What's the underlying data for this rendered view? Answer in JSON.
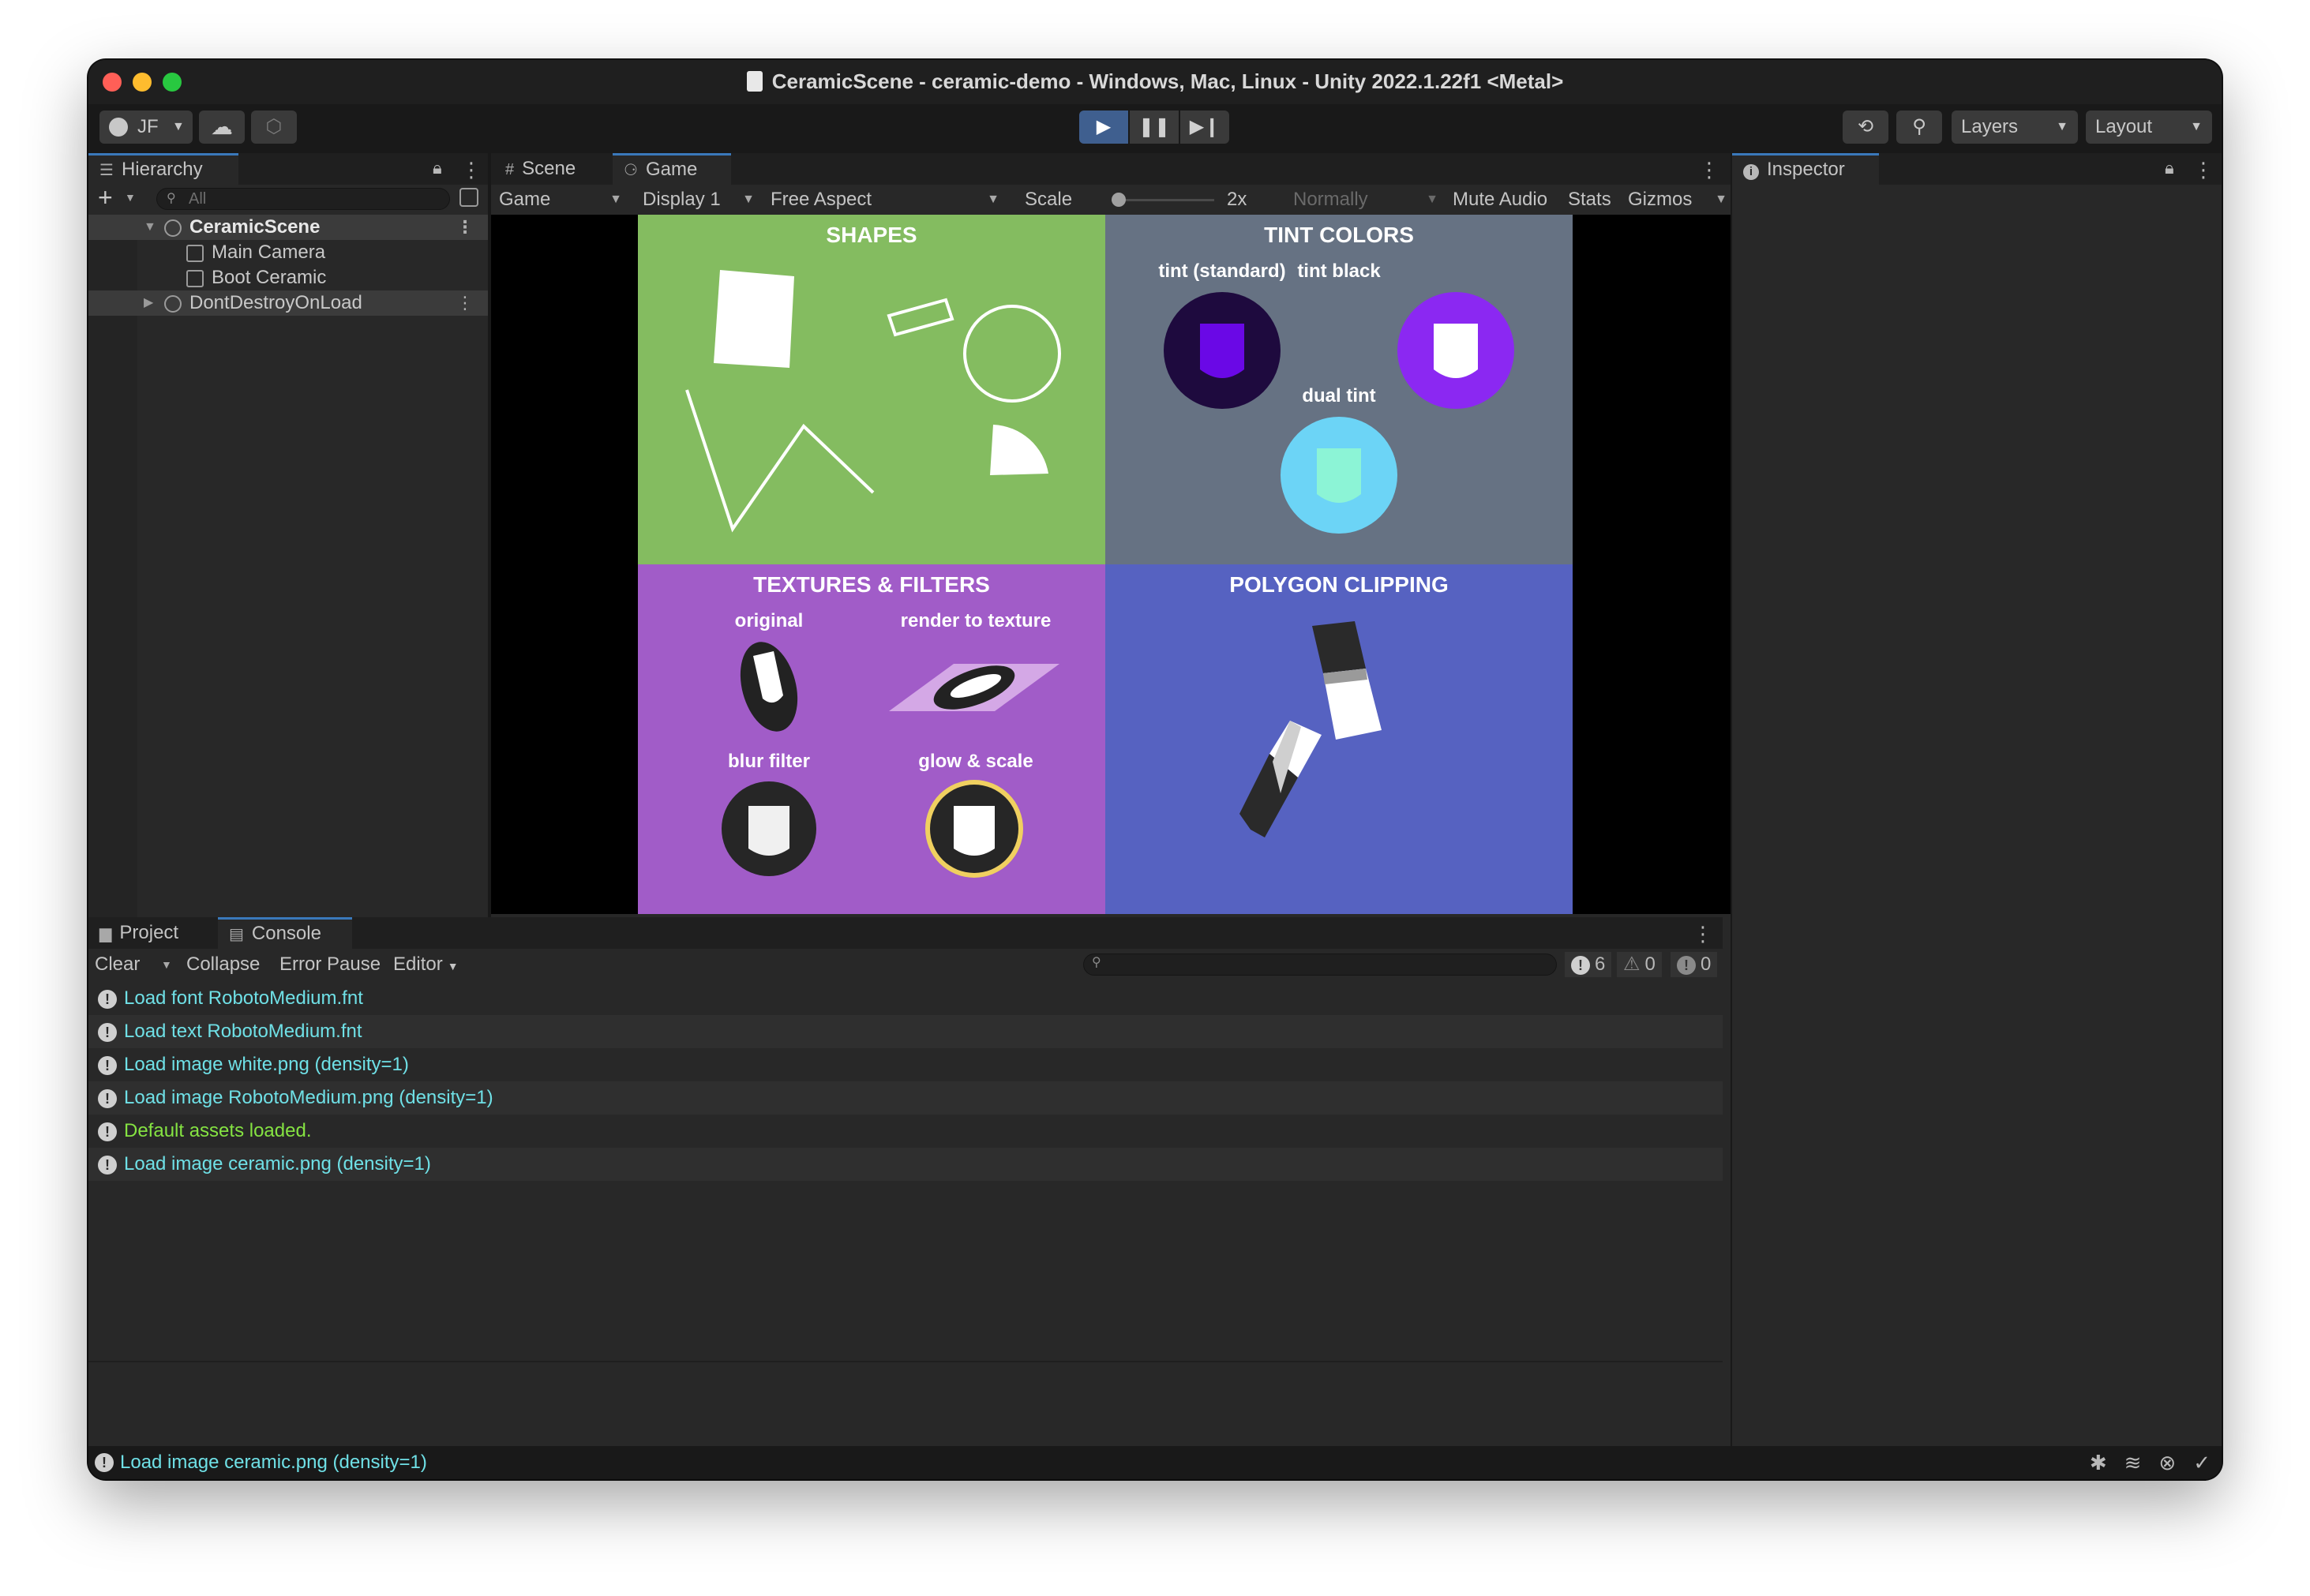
{
  "window": {
    "title": "CeramicScene - ceramic-demo - Windows, Mac, Linux - Unity 2022.1.22f1 <Metal>"
  },
  "toolbar": {
    "account_label": "JF",
    "account_icon": "user-circle-icon",
    "cloud_icon": "cloud-icon",
    "collab_icon": "collab-icon",
    "play_icon": "play-icon",
    "pause_icon": "pause-icon",
    "step_icon": "step-icon",
    "history_icon": "history-icon",
    "search_icon": "search-icon",
    "layers_label": "Layers",
    "layout_label": "Layout",
    "play_active_color": "#3f5f8f"
  },
  "hierarchy": {
    "tab_label": "Hierarchy",
    "search_placeholder": "All",
    "items": [
      {
        "label": "CeramicScene",
        "type": "scene",
        "expanded": true
      },
      {
        "label": "Main Camera",
        "type": "object"
      },
      {
        "label": "Boot Ceramic",
        "type": "object"
      },
      {
        "label": "DontDestroyOnLoad",
        "type": "scene",
        "expanded": false
      }
    ]
  },
  "game": {
    "tabs": [
      {
        "label": "Scene",
        "icon": "grid-icon"
      },
      {
        "label": "Game",
        "icon": "gamepad-icon"
      }
    ],
    "options": {
      "mode": "Game",
      "display": "Display 1",
      "aspect": "Free Aspect",
      "scale_label": "Scale",
      "scale_value": "2x",
      "scale_level": 0,
      "play_focus": "Normally",
      "mute": "Mute Audio",
      "stats": "Stats",
      "gizmos": "Gizmos"
    },
    "quadrants": {
      "shapes": {
        "title": "SHAPES",
        "color": "#84bc60"
      },
      "tint": {
        "title": "TINT COLORS",
        "color": "#667283",
        "labels": [
          "tint (standard)",
          "tint black",
          "dual tint"
        ]
      },
      "textures": {
        "title": "TEXTURES & FILTERS",
        "color": "#a15cc8",
        "labels": [
          "original",
          "render to texture",
          "blur filter",
          "glow & scale"
        ]
      },
      "polygon": {
        "title": "POLYGON CLIPPING",
        "color": "#5662c1"
      }
    }
  },
  "console": {
    "tabs": [
      {
        "label": "Project",
        "icon": "folder-icon"
      },
      {
        "label": "Console",
        "icon": "console-icon"
      }
    ],
    "toolbar": {
      "clear": "Clear",
      "collapse": "Collapse",
      "error_pause": "Error Pause",
      "editor": "Editor",
      "info_count": "6",
      "warn_count": "0",
      "error_count": "0"
    },
    "logs": [
      {
        "text": "Load font RobotoMedium.fnt",
        "color": "#6fe0e6"
      },
      {
        "text": "Load text RobotoMedium.fnt",
        "color": "#6fe0e6"
      },
      {
        "text": "Load image white.png (density=1)",
        "color": "#6fe0e6"
      },
      {
        "text": "Load image RobotoMedium.png (density=1)",
        "color": "#6fe0e6"
      },
      {
        "text": "Default assets loaded.",
        "color": "#85e342"
      },
      {
        "text": "Load image ceramic.png (density=1)",
        "color": "#6fe0e6"
      }
    ]
  },
  "inspector": {
    "tab_label": "Inspector",
    "icon": "info-icon"
  },
  "statusbar": {
    "message": "Load image ceramic.png (density=1)",
    "icons": [
      "bug-icon",
      "stack-icon",
      "network-icon",
      "check-circle-icon"
    ]
  }
}
